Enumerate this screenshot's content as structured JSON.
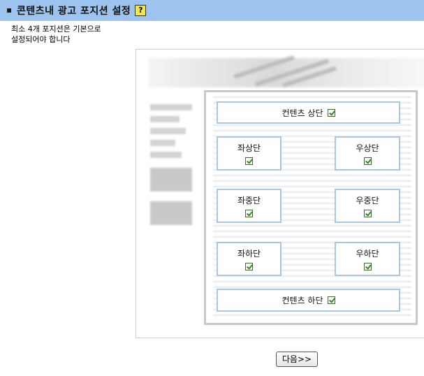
{
  "header": {
    "title": "콘텐츠내 광고 포지션 설정",
    "help_icon": "?"
  },
  "description": {
    "line1": "최소 4개 포지션은 기본으로",
    "line2": "설정되어야 합니다"
  },
  "positions": {
    "top": {
      "label": "컨텐츠 상단",
      "checked": true
    },
    "left_top": {
      "label": "좌상단",
      "checked": true
    },
    "right_top": {
      "label": "우상단",
      "checked": true
    },
    "left_mid": {
      "label": "좌중단",
      "checked": true
    },
    "right_mid": {
      "label": "우중단",
      "checked": true
    },
    "left_bottom": {
      "label": "좌하단",
      "checked": true
    },
    "right_bottom": {
      "label": "우하단",
      "checked": true
    },
    "bottom": {
      "label": "컨텐츠 하단",
      "checked": true
    }
  },
  "next_button": {
    "label": "다음>>"
  },
  "colors": {
    "header_bg": "#9cc4ee",
    "slot_border": "#a9c7e2",
    "check": "#2e8b1e"
  }
}
